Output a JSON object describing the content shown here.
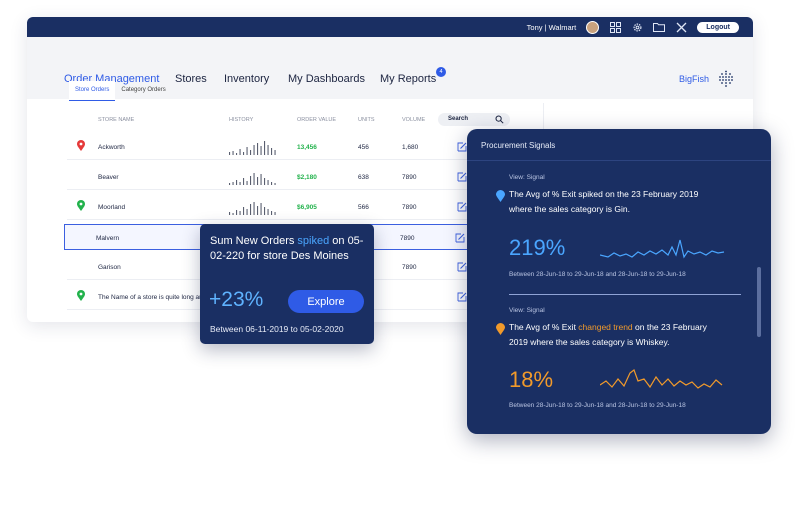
{
  "topbar": {
    "user": "Tony | Walmart",
    "logout_label": "Logout"
  },
  "nav": {
    "items": [
      "Order Management",
      "Stores",
      "Inventory",
      "My Dashboards",
      "My Reports"
    ],
    "reports_badge": "4",
    "brand": "BigFish",
    "accent": "#2f5be6"
  },
  "subtabs": [
    "Store Orders",
    "Category Orders"
  ],
  "table": {
    "columns": [
      "STORE NAME",
      "HISTORY",
      "ORDER VALUE",
      "UNITS",
      "VOLUME"
    ],
    "search_label": "Search",
    "rows": [
      {
        "pin": "red",
        "name": "Ackworth",
        "value": "13,456",
        "units": "456",
        "volume": "1,680"
      },
      {
        "pin": "",
        "name": "Beaver",
        "value": "$2,180",
        "units": "638",
        "volume": "7890"
      },
      {
        "pin": "green",
        "name": "Moorland",
        "value": "$6,905",
        "units": "566",
        "volume": "7890"
      },
      {
        "pin": "",
        "name": "Malvern",
        "value": "",
        "units": "",
        "volume": "7890"
      },
      {
        "pin": "",
        "name": "Garison",
        "value": "",
        "units": "",
        "volume": "7890"
      },
      {
        "pin": "green",
        "name": "The Name of a store is quite long and",
        "value": "",
        "units": "",
        "volume": ""
      }
    ]
  },
  "tooltip": {
    "msg_a": "Sum New Orders ",
    "msg_hl": "spiked",
    "msg_b": " on 05-02-220 for store Des Moines",
    "change": "+23%",
    "explore_label": "Explore",
    "range": "Between 06-11-2019 to 05-02-2020"
  },
  "signals": {
    "title": "Procurement Signals",
    "items": [
      {
        "view": "View: Signal",
        "text": "The Avg of % Exit spiked on the 23 February 2019 where the sales category is Gin.",
        "value": "219%",
        "range": "Between 28-Jun-18 to 29-Jun-18 and 28-Jun-18 to 29-Jun-18",
        "color": "#4aa6ff"
      },
      {
        "view": "View: Signal",
        "text_a": "The Avg of % Exit ",
        "text_hl": "changed trend",
        "text_b": " on the 23 February 2019 where the sales category is Whiskey.",
        "value": "18%",
        "range": "Between 28-Jun-18 to 29-Jun-18 and 28-Jun-18 to 29-Jun-18",
        "color": "#f19a2b"
      }
    ]
  }
}
